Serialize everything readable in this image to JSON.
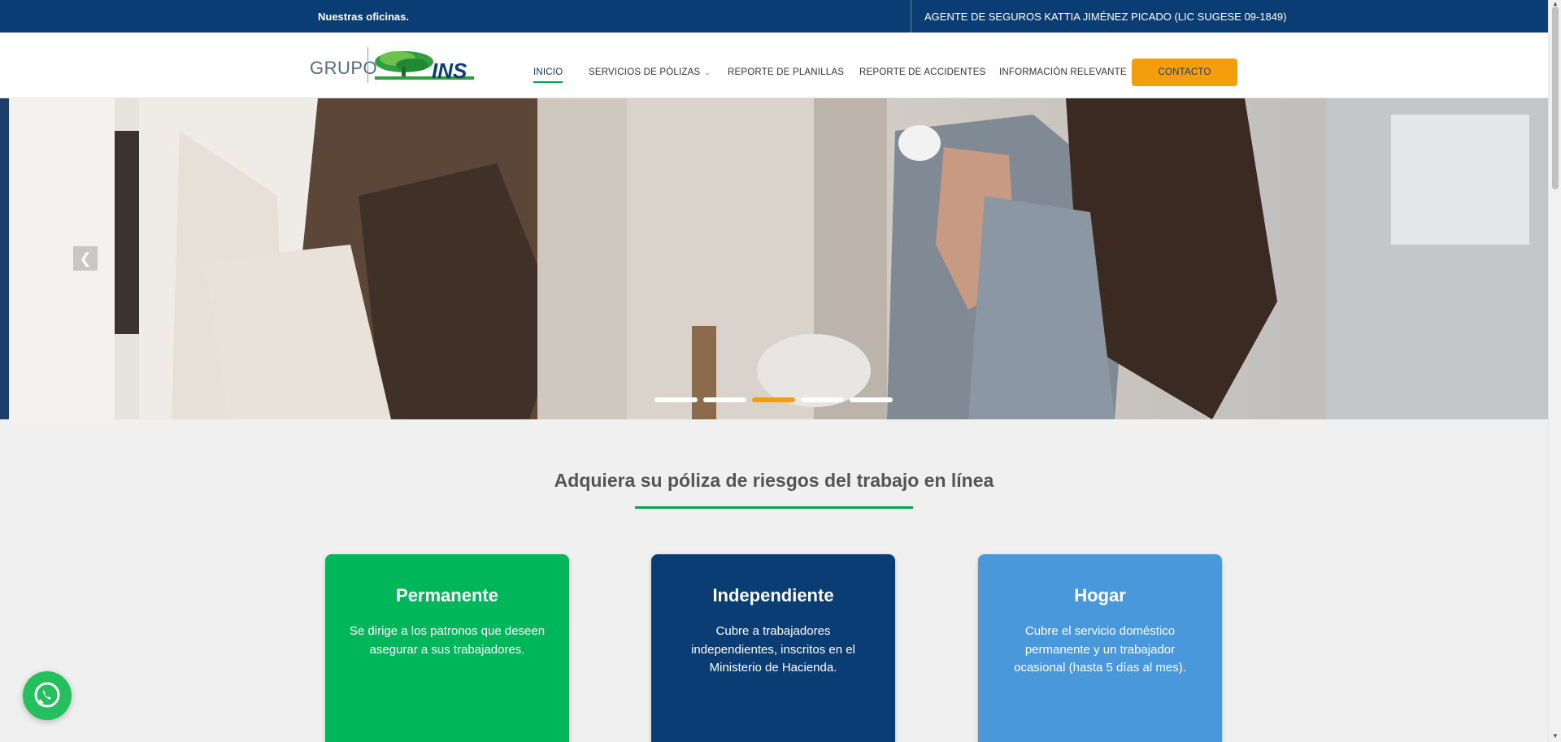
{
  "topbar": {
    "offices_label": "Nuestras oficinas.",
    "agent_label": "AGENTE DE SEGUROS KATTIA JIMÉNEZ PICADO (LIC SUGESE 09-1849)"
  },
  "logo": {
    "grupo": "GRUPO",
    "ins": "INS"
  },
  "nav": {
    "items": [
      {
        "label": "INICIO",
        "active": true
      },
      {
        "label": "SERVICIOS DE PÓLIZAS",
        "dropdown": true
      },
      {
        "label": "REPORTE DE PLANILLAS"
      },
      {
        "label": "REPORTE DE ACCIDENTES"
      },
      {
        "label": "INFORMACIÓN RELEVANTE"
      }
    ],
    "contact_label": "CONTACTO",
    "dropdown_icon": "chevron-down-icon"
  },
  "slider": {
    "prev_icon": "chevron-left-icon",
    "slide_count": 5,
    "active_slide": 3
  },
  "section": {
    "title": "Adquiera su póliza de riesgos del trabajo en línea"
  },
  "cards": [
    {
      "title": "Permanente",
      "text": "Se dirige a los patronos que deseen asegurar a sus trabajadores.",
      "color": "#00b65a"
    },
    {
      "title": "Independiente",
      "text": "Cubre a trabajadores independientes, inscritos en el Ministerio de Hacienda.",
      "color": "#0b3d75"
    },
    {
      "title": "Hogar",
      "text": "Cubre el servicio doméstico permanente y un trabajador ocasional (hasta 5 días al mes).",
      "color": "#4a98dc"
    }
  ],
  "whatsapp": {
    "icon": "whatsapp-icon"
  },
  "colors": {
    "primary": "#0b3d75",
    "accent": "#f59e0b",
    "green": "#00a650"
  }
}
